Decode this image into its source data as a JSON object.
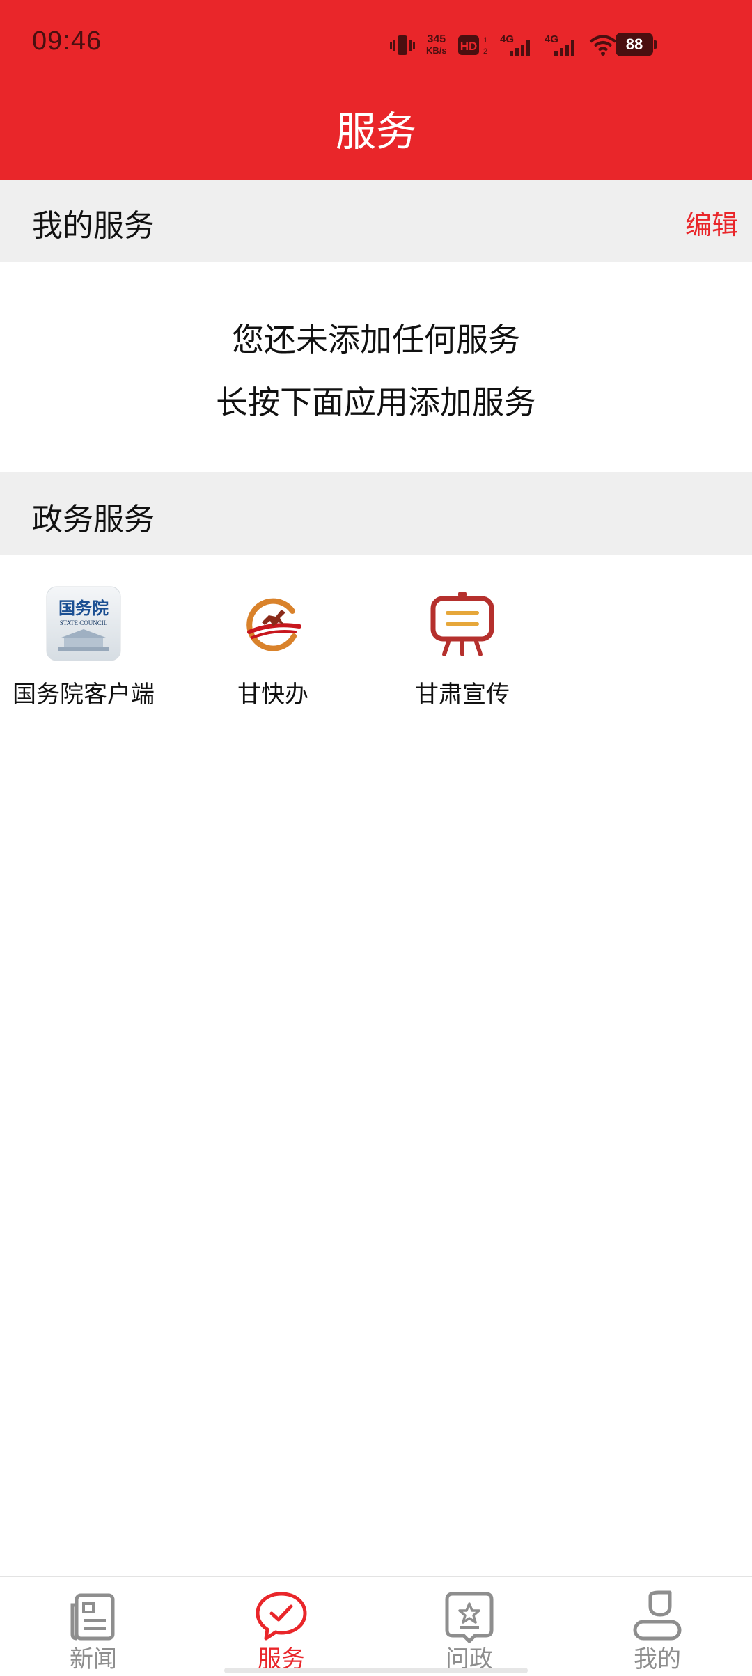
{
  "status_bar": {
    "time": "09:46",
    "net_speed_value": "345",
    "net_speed_unit": "KB/s",
    "battery": "88",
    "icons": [
      "vibrate-icon",
      "hd-icon",
      "signal-4g-icon",
      "signal-4g-icon",
      "wifi-icon",
      "battery-icon"
    ]
  },
  "header": {
    "title": "服务"
  },
  "my_services": {
    "title": "我的服务",
    "edit_label": "编辑",
    "empty_line1": "您还未添加任何服务",
    "empty_line2": "长按下面应用添加服务"
  },
  "gov_services": {
    "title": "政务服务",
    "apps": [
      {
        "label": "国务院客户端",
        "icon": "state-council-icon",
        "icon_text": "国务院",
        "icon_subtext": "STATE COUNCIL"
      },
      {
        "label": "甘快办",
        "icon": "gan-kuai-ban-horse-icon"
      },
      {
        "label": "甘肃宣传",
        "icon": "gansu-propaganda-board-icon"
      }
    ]
  },
  "bottom_nav": {
    "items": [
      {
        "label": "新闻",
        "icon": "newspaper-icon",
        "active": false
      },
      {
        "label": "服务",
        "icon": "chat-check-icon",
        "active": true
      },
      {
        "label": "问政",
        "icon": "star-card-icon",
        "active": false
      },
      {
        "label": "我的",
        "icon": "person-icon",
        "active": false
      }
    ]
  },
  "colors": {
    "accent": "#e9262a",
    "section_bg": "#efefef",
    "nav_inactive": "#8e8e8e",
    "status_dark": "#4a0f10"
  }
}
